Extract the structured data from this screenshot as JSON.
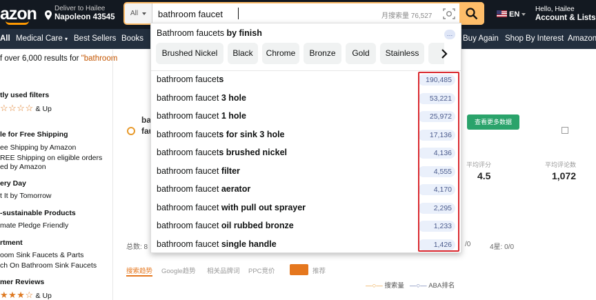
{
  "nav": {
    "logo": "azon",
    "deliver_line1": "Deliver to Hailee",
    "deliver_line2": "Napoleon 43545",
    "search_category": "All",
    "search_value": "bathroom faucet",
    "monthly_search": "月搜索量 76,527",
    "lang": "EN",
    "account_line1": "Hello, Hailee",
    "account_line2": "Account & Lists"
  },
  "subnav": {
    "all": "All",
    "medical": "Medical Care",
    "bestsellers": "Best Sellers",
    "books": "Books",
    "buyagain": "Buy Again",
    "shopinterest": "Shop By Interest",
    "amazon": "Amazon"
  },
  "results": {
    "prefix": "f over 6,000 results for ",
    "query": "\"bathroom"
  },
  "sidebar": {
    "recent": "tly used filters",
    "andup1": "& Up",
    "free_ship": "le for Free Shipping",
    "free_ship_1": "ee Shipping by Amazon",
    "free_ship_2": "REE Shipping on eligible orders",
    "free_ship_3": "ed by Amazon",
    "delivery": "ery Day",
    "delivery_1": "t It by Tomorrow",
    "sustainable": "-sustainable Products",
    "sustainable_1": "mate Pledge Friendly",
    "department": "rtment",
    "dept_1": "oom Sink Faucets & Parts",
    "dept_2": "ch On Bathroom Sink Faucets",
    "reviews": "mer Reviews",
    "andup2": "& Up"
  },
  "background": {
    "left_title_1": "ba",
    "left_title_2": "fau",
    "green_btn": "查看更多数据",
    "num_a": "4.5",
    "num_b": "1,072",
    "label_a": "平均评分",
    "label_b": "平均评论数",
    "total": "总数: 8",
    "ratio_1": "/0",
    "ratio_2": "4星: 0/0",
    "tab_1": "搜索趋势",
    "tab_2": "Google趋势",
    "tab_3": "相关品牌词",
    "tab_4": "PPC竞价",
    "tab_5": "推荐",
    "legend_1": "搜索量",
    "legend_2": "ABA排名"
  },
  "dropdown": {
    "finish_prefix": "Bathroom faucets ",
    "finish_bold": "by finish",
    "chips": [
      "Brushed Nickel",
      "Black",
      "Chrome",
      "Bronze",
      "Gold",
      "Stainless"
    ],
    "suggestions": [
      {
        "base": "bathroom faucet",
        "bold": "s",
        "count": "190,485"
      },
      {
        "base": "bathroom faucet ",
        "bold": "3 hole",
        "count": "53,221"
      },
      {
        "base": "bathroom faucet ",
        "bold": "1 hole",
        "count": "25,972"
      },
      {
        "base": "bathroom faucet",
        "bold": "s for sink 3 hole",
        "count": "17,136"
      },
      {
        "base": "bathroom faucet",
        "bold": "s brushed nickel",
        "count": "4,136"
      },
      {
        "base": "bathroom faucet ",
        "bold": "filter",
        "count": "4,555"
      },
      {
        "base": "bathroom faucet ",
        "bold": "aerator",
        "count": "4,170"
      },
      {
        "base": "bathroom faucet ",
        "bold": "with pull out sprayer",
        "count": "2,295"
      },
      {
        "base": "bathroom faucet ",
        "bold": "oil rubbed bronze",
        "count": "1,233"
      },
      {
        "base": "bathroom faucet ",
        "bold": "single handle",
        "count": "1,426"
      }
    ]
  },
  "colors": {
    "nav_bg": "#131921",
    "subnav_bg": "#232f3e",
    "accent": "#febd69",
    "highlight_box": "#d9262c"
  }
}
